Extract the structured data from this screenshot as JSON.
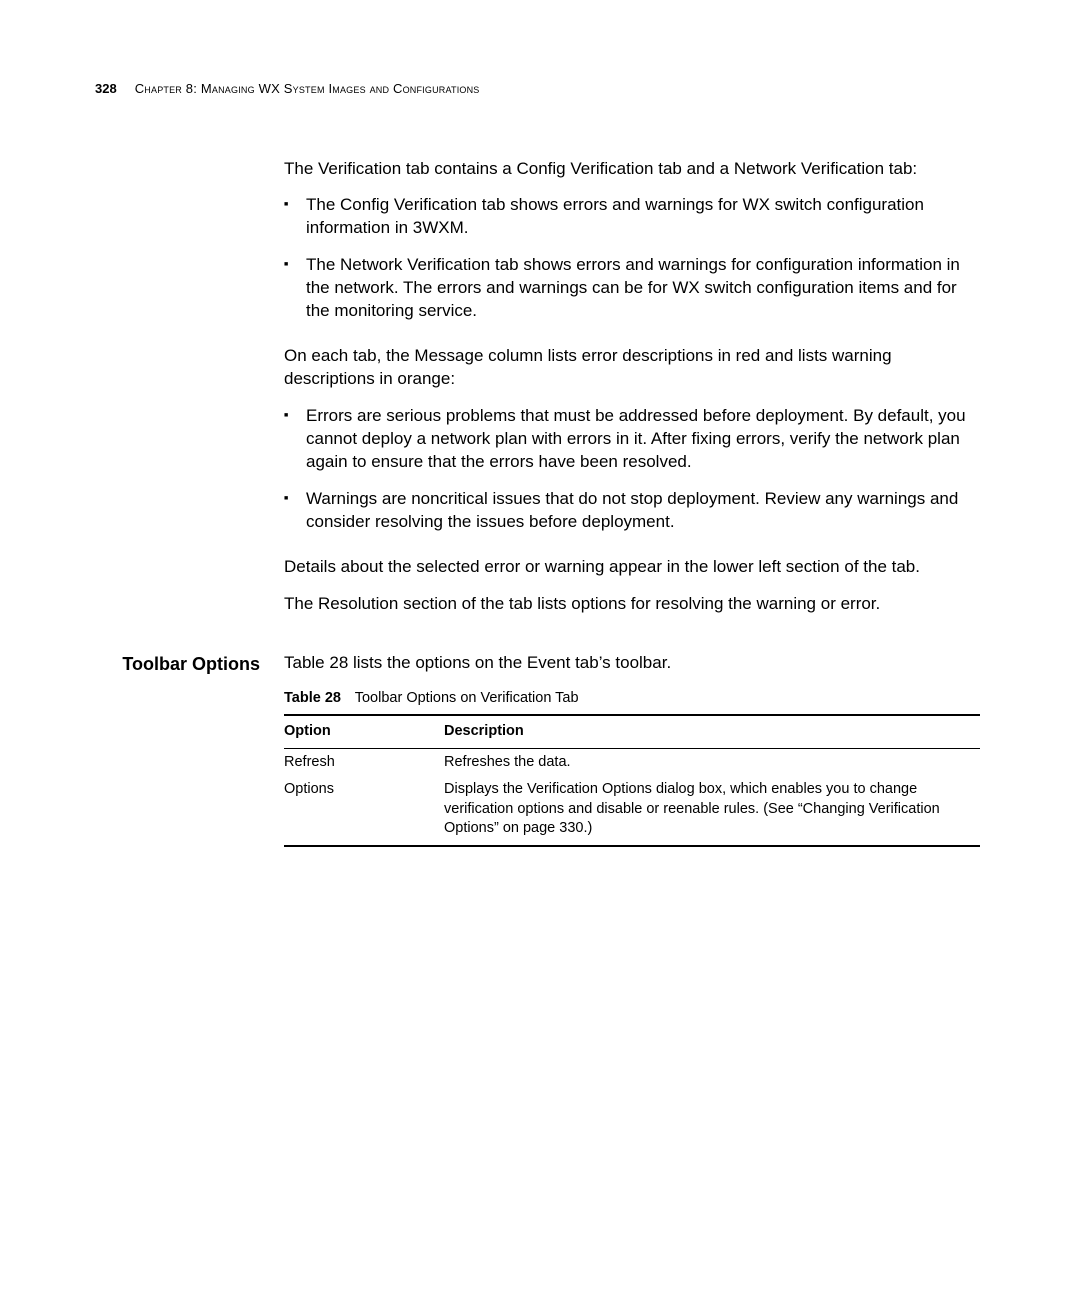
{
  "pageNumber": "328",
  "chapter": "Chapter 8: Managing WX System Images and Configurations",
  "body": {
    "intro": "The Verification tab contains a Config Verification tab and a Network Verification tab:",
    "tabs": [
      "The Config Verification tab shows errors and warnings for WX switch configuration information in 3WXM.",
      "The Network Verification tab shows errors and warnings for configuration information in the network. The errors and warnings can be for WX switch configuration items and for the monitoring service."
    ],
    "colorIntro": "On each tab, the Message column lists error descriptions in red and lists warning descriptions in orange:",
    "severity": [
      "Errors are serious problems that must be addressed before deployment. By default, you cannot deploy a network plan with errors in it. After fixing errors, verify the network plan again to ensure that the errors have been resolved.",
      "Warnings are noncritical issues that do not stop deployment. Review any warnings and consider resolving the issues before deployment."
    ],
    "details": "Details about the selected error or warning appear in the lower left section of the tab.",
    "resolution": "The Resolution section of the tab lists options for resolving the warning or error."
  },
  "toolbarSection": {
    "heading": "Toolbar Options",
    "lead": "Table 28 lists the options on the Event tab’s toolbar.",
    "tableLabel": "Table 28",
    "tableTitle": "Toolbar Options on Verification Tab",
    "headers": {
      "option": "Option",
      "description": "Description"
    },
    "rows": [
      {
        "option": "Refresh",
        "description": "Refreshes the data."
      },
      {
        "option": "Options",
        "description": "Displays the Verification Options dialog box, which enables you to change verification options and disable or reenable rules. (See “Changing Verification Options” on page 330.)"
      }
    ]
  }
}
